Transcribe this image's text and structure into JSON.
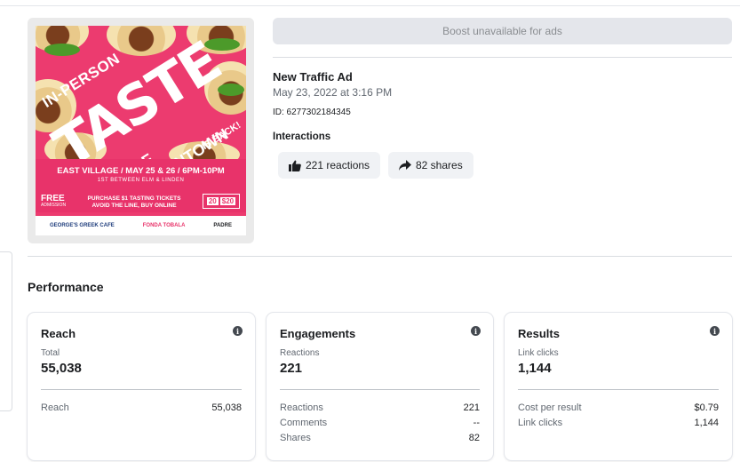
{
  "ad": {
    "boost_label": "Boost unavailable for ads",
    "title": "New Traffic Ad",
    "date": "May 23, 2022 at 3:16 PM",
    "id_text": "ID: 6277302184345",
    "interactions_label": "Interactions",
    "reactions_label": "221 reactions",
    "shares_label": "82 shares"
  },
  "poster": {
    "line1": "IN-PERSON",
    "line2": "TASTE",
    "line3": "OF DOWNTOWN",
    "line4": "IS BACK!",
    "event": "EAST VILLAGE / MAY 25 & 26 / 6PM-10PM",
    "sub": "1ST BETWEEN ELM & LINDEN",
    "free": "FREE",
    "free_sub": "ADMISSION",
    "buy": "PURCHASE $1 TASTING TICKETS AVOID THE LINE, BUY ONLINE",
    "price_a": "20",
    "price_b": "$20",
    "sponsor1": "GEORGE'S GREEK CAFE",
    "sponsor2": "FONDA TOBALA",
    "sponsor3": "PADRE"
  },
  "performance": {
    "title": "Performance",
    "cards": [
      {
        "title": "Reach",
        "sub": "Total",
        "big": "55,038",
        "rows": [
          {
            "label": "Reach",
            "value": "55,038"
          }
        ]
      },
      {
        "title": "Engagements",
        "sub": "Reactions",
        "big": "221",
        "rows": [
          {
            "label": "Reactions",
            "value": "221"
          },
          {
            "label": "Comments",
            "value": "--"
          },
          {
            "label": "Shares",
            "value": "82"
          }
        ]
      },
      {
        "title": "Results",
        "sub": "Link clicks",
        "big": "1,144",
        "rows": [
          {
            "label": "Cost per result",
            "value": "$0.79"
          },
          {
            "label": "Link clicks",
            "value": "1,144"
          }
        ]
      }
    ]
  },
  "colors": {
    "poster_pink": "#ec3b6f",
    "button_grey": "#e4e6eb",
    "pill_bg": "#f0f2f5"
  }
}
